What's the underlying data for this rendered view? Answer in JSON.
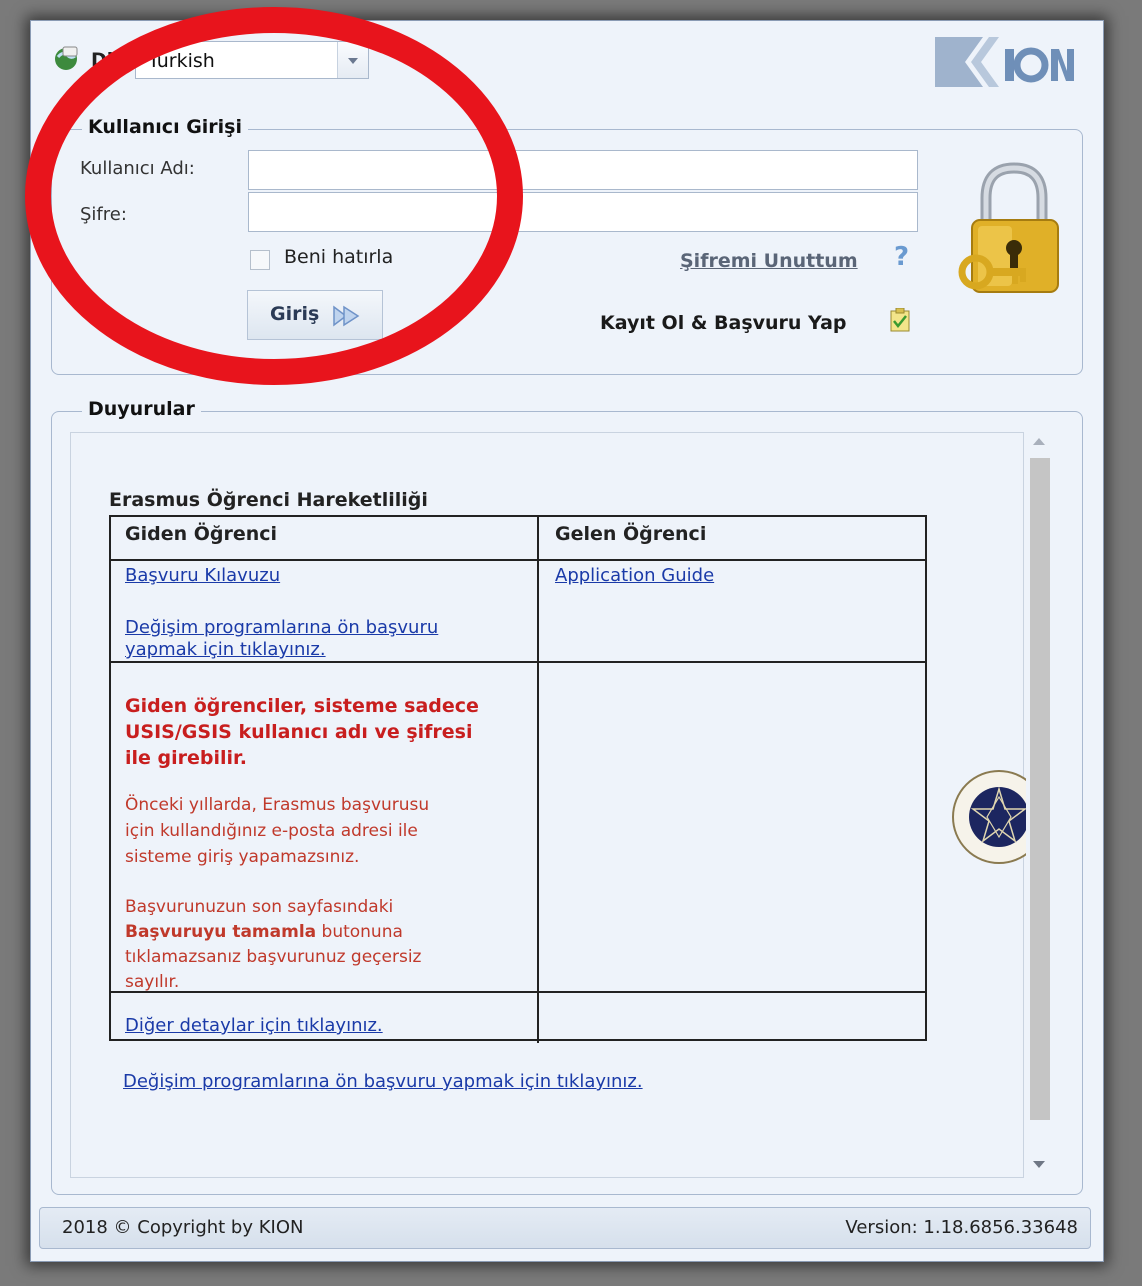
{
  "language": {
    "label": "Dil:",
    "selected": "Turkish"
  },
  "logo": {
    "text": "KION"
  },
  "login": {
    "legend": "Kullanıcı Girişi",
    "username_label": "Kullanıcı Adı:",
    "username_value": "",
    "password_label": "Şifre:",
    "password_value": "",
    "remember_label": "Beni hatırla",
    "remember_checked": false,
    "forgot_link": "Şifremi Unuttum",
    "submit_label": "Giriş",
    "register_link": "Kayıt Ol & Başvuru Yap"
  },
  "announcements": {
    "legend": "Duyurular",
    "title": "Erasmus Öğrenci Hareketliliği",
    "col_outgoing": "Giden Öğrenci",
    "col_incoming": "Gelen Öğrenci",
    "outgoing_guide": "Başvuru Kılavuzu",
    "outgoing_apply_line1": "Değişim programlarına ön başvuru",
    "outgoing_apply_line2": "yapmak için tıklayınız.",
    "incoming_guide": "Application Guide",
    "warning_line1": "Giden öğrenciler, sisteme sadece",
    "warning_line2": "USIS/GSIS kullanıcı adı ve şifresi",
    "warning_line3": "ile girebilir.",
    "note1_line1": "Önceki yıllarda, Erasmus başvurusu",
    "note1_line2": "için kullandığınız e-posta adresi ile",
    "note1_line3": "sisteme giriş yapamazsınız.",
    "note2_line1": "Başvurunuzun son sayfasındaki",
    "note2_bold": "Başvuruyu tamamla",
    "note2_line2_rest": " butonuna",
    "note2_line3": "tıklamazsanız başvurunuz geçersiz",
    "note2_line4": "sayılır.",
    "details_link": "Diğer detaylar için tıklayınız.",
    "footer_link": "Değişim programlarına ön başvuru yapmak için tıklayınız."
  },
  "footer": {
    "copyright": "2018 © Copyright by KION",
    "version": "Version: 1.18.6856.33648"
  },
  "colors": {
    "background": "#eef3fa",
    "border": "#a8b8cf",
    "link": "#1a3aa8",
    "warning": "#c81e1e",
    "annotation_circle": "#e8141c"
  },
  "icons": [
    "globe-icon",
    "lock-key-icon",
    "help-icon",
    "arrow-right-icon",
    "clipboard-check-icon",
    "university-seal-icon"
  ]
}
